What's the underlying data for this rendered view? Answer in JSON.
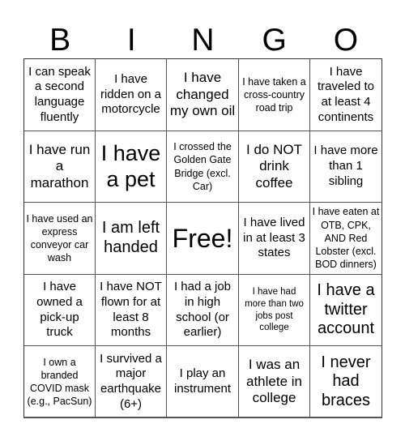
{
  "header": {
    "letters": [
      "B",
      "I",
      "N",
      "G",
      "O"
    ]
  },
  "board": {
    "rows": [
      [
        {
          "text": "I can speak a second language fluently",
          "size": "md"
        },
        {
          "text": "I have ridden on a motorcycle",
          "size": "md"
        },
        {
          "text": "I have changed my own oil",
          "size": "lg"
        },
        {
          "text": "I have taken a cross-country road trip",
          "size": "sm"
        },
        {
          "text": "I have traveled to at least 4 continents",
          "size": "md"
        }
      ],
      [
        {
          "text": "I have run a marathon",
          "size": "lg"
        },
        {
          "text": "I have a pet",
          "size": "xxl"
        },
        {
          "text": "I crossed the Golden Gate Bridge (excl. Car)",
          "size": "sm"
        },
        {
          "text": "I do NOT drink coffee",
          "size": "lg"
        },
        {
          "text": "I have more than 1 sibling",
          "size": "md"
        }
      ],
      [
        {
          "text": "I have used an express conveyor car wash",
          "size": "sm"
        },
        {
          "text": "I am left handed",
          "size": "xl"
        },
        {
          "text": "Free!",
          "size": "free",
          "free": true
        },
        {
          "text": "I have lived in at least 3 states",
          "size": "md"
        },
        {
          "text": "I have eaten at OTB, CPK, AND Red Lobster (excl. BOD dinners)",
          "size": "sm"
        }
      ],
      [
        {
          "text": "I have owned a pick-up truck",
          "size": "md"
        },
        {
          "text": "I have NOT flown for at least 8 months",
          "size": "md"
        },
        {
          "text": "I had a job in high school (or earlier)",
          "size": "md"
        },
        {
          "text": "I have had more than two jobs post college",
          "size": "xs"
        },
        {
          "text": "I have a twitter account",
          "size": "xl"
        }
      ],
      [
        {
          "text": "I own a branded COVID mask (e.g., PacSun)",
          "size": "sm"
        },
        {
          "text": "I survived a major earthquake (6+)",
          "size": "md"
        },
        {
          "text": "I play an instrument",
          "size": "md"
        },
        {
          "text": "I was an athlete in college",
          "size": "lg"
        },
        {
          "text": "I never had braces",
          "size": "xl"
        }
      ]
    ]
  }
}
